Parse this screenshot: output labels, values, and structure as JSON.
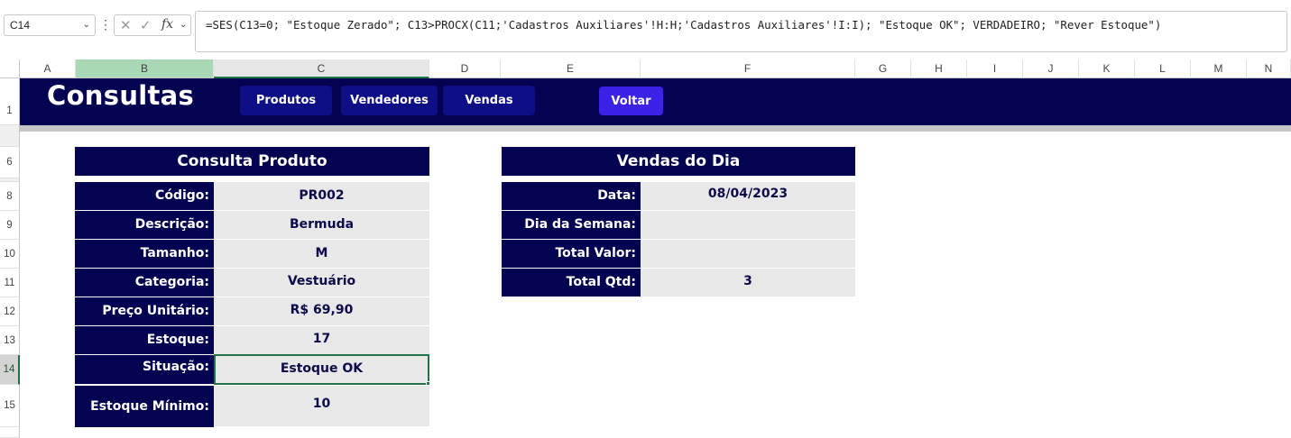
{
  "formula_bar": {
    "name_box": "C14",
    "formula": "=SES(C13=0; \"Estoque Zerado\"; C13>PROCX(C11;'Cadastros Auxiliares'!H:H;'Cadastros Auxiliares'!I:I); \"Estoque OK\"; VERDADEIRO; \"Rever Estoque\")"
  },
  "columns": [
    "A",
    "B",
    "C",
    "D",
    "E",
    "F",
    "G",
    "H",
    "I",
    "J",
    "K",
    "L",
    "M",
    "N"
  ],
  "rows": [
    "1",
    "6",
    "8",
    "9",
    "10",
    "11",
    "12",
    "13",
    "14",
    "15"
  ],
  "banner": {
    "title": "Consultas",
    "nav": [
      "Produtos",
      "Vendedores",
      "Vendas"
    ],
    "back": "Voltar"
  },
  "consulta_produto": {
    "header": "Consulta Produto",
    "fields": [
      {
        "label": "Código:",
        "value": "PR002"
      },
      {
        "label": "Descrição:",
        "value": "Bermuda"
      },
      {
        "label": "Tamanho:",
        "value": "M"
      },
      {
        "label": "Categoria:",
        "value": "Vestuário"
      },
      {
        "label": "Preço Unitário:",
        "value": "R$ 69,90"
      },
      {
        "label": "Estoque:",
        "value": "17"
      },
      {
        "label": "Situação:",
        "value": "Estoque OK"
      },
      {
        "label": "Estoque Mínimo:",
        "value": "10"
      }
    ]
  },
  "vendas_do_dia": {
    "header": "Vendas do Dia",
    "fields": [
      {
        "label": "Data:",
        "value": "08/04/2023"
      },
      {
        "label": "Dia da Semana:",
        "value": ""
      },
      {
        "label": "Total Valor:",
        "value": ""
      },
      {
        "label": "Total Qtd:",
        "value": "3"
      }
    ]
  },
  "colors": {
    "navy": "#030352",
    "nav_button": "#0e0e86",
    "back_button": "#3b22e6",
    "cell_fill": "#e8e8e8",
    "selection": "#217346"
  }
}
